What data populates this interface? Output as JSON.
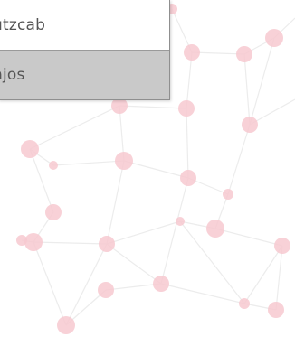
{
  "dropdown": {
    "items": [
      {
        "label": "utzcab",
        "selected": false
      },
      {
        "label": "njos",
        "selected": true
      }
    ]
  },
  "colors": {
    "node": "#f7c9d0",
    "edge": "#ececec",
    "selected_bg": "#c9c9c9",
    "menu_border": "#8f8f8f"
  }
}
